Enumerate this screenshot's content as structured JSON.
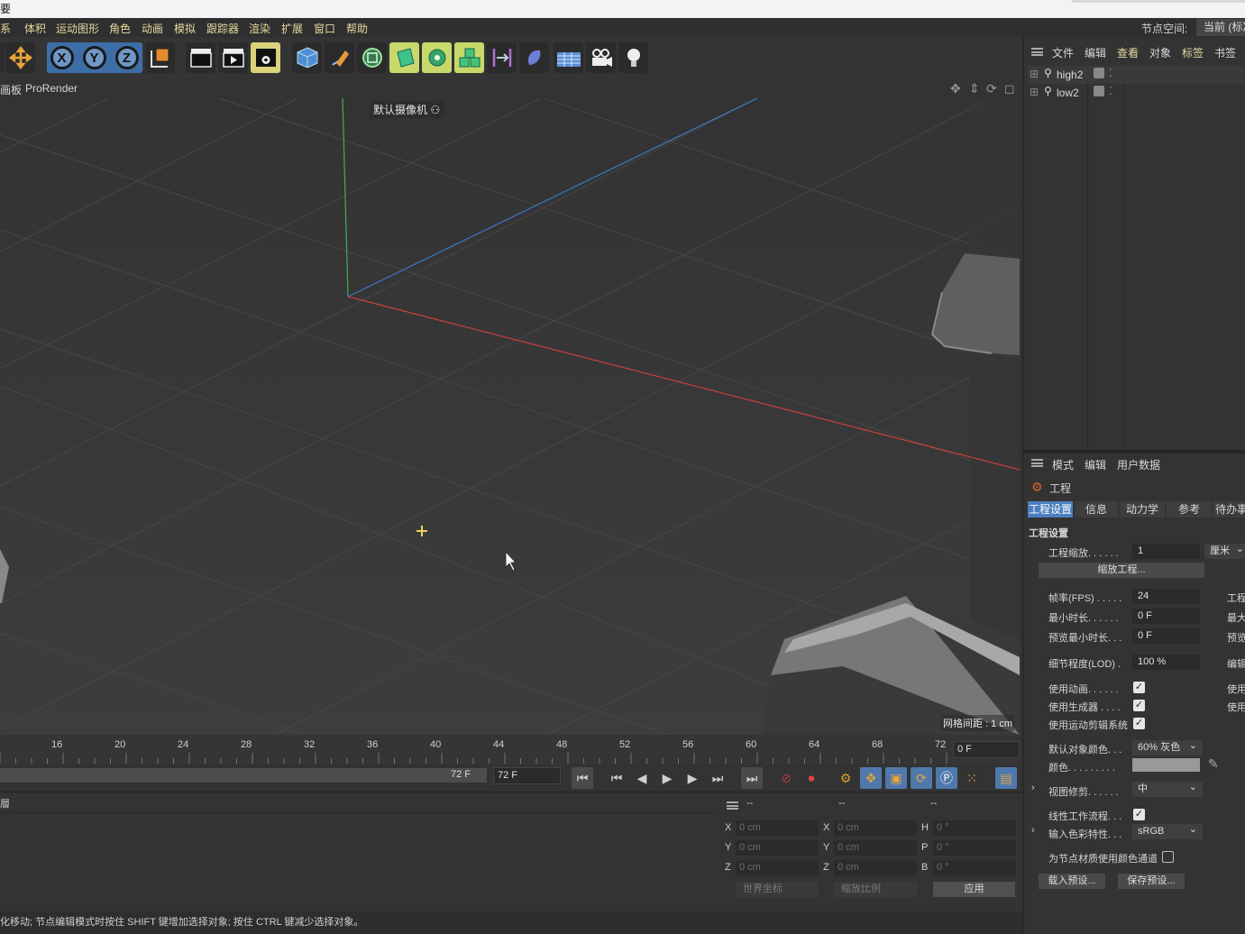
{
  "window": {
    "title_fragment": "要"
  },
  "menubar": {
    "items": [
      "系",
      "体积",
      "运动图形",
      "角色",
      "动画",
      "模拟",
      "跟踪器",
      "渲染",
      "扩展",
      "窗口",
      "帮助"
    ],
    "node_space_label": "节点空间:",
    "node_space_value": "当前 (标准"
  },
  "viewport_header": {
    "left_label": "画板",
    "pro_render": "ProRender"
  },
  "viewport": {
    "camera_label": "默认摄像机",
    "grid_distance": "网格间距 : 1 cm"
  },
  "timeline": {
    "ticks": [
      "16",
      "20",
      "24",
      "28",
      "32",
      "36",
      "40",
      "44",
      "48",
      "52",
      "56",
      "60",
      "64",
      "68",
      "72"
    ],
    "current_frame": "0 F",
    "range_end": "72 F",
    "end_frame": "72 F"
  },
  "coordinates": {
    "col_headers": [
      "--",
      "--",
      "--"
    ],
    "rows": [
      {
        "l1": "X",
        "v1": "0 cm",
        "l2": "X",
        "v2": "0 cm",
        "l3": "H",
        "v3": "0 °"
      },
      {
        "l1": "Y",
        "v1": "0 cm",
        "l2": "Y",
        "v2": "0 cm",
        "l3": "P",
        "v3": "0 °"
      },
      {
        "l1": "Z",
        "v1": "0 cm",
        "l2": "Z",
        "v2": "0 cm",
        "l3": "B",
        "v3": "0 °"
      }
    ],
    "world_coords": "世界坐标",
    "scale_ratio": "缩放比例",
    "apply": "应用"
  },
  "bottom_left_label": "層",
  "status": "化移动; 节点编辑模式时按住 SHIFT 键增加选择对象; 按住 CTRL 键减少选择对象。",
  "object_manager": {
    "menu": [
      "文件",
      "编辑",
      "查看",
      "对象",
      "标签",
      "书签"
    ],
    "objects": [
      "high2",
      "low2"
    ]
  },
  "attribute_manager": {
    "menu": [
      "模式",
      "编辑",
      "用户数据"
    ],
    "title": "工程",
    "tabs": [
      "工程设置",
      "信息",
      "动力学",
      "参考",
      "待办事"
    ],
    "section": "工程设置",
    "scale_label": "工程缩放. . . . . .",
    "scale_value": "1",
    "scale_unit": "厘米",
    "scale_button": "缩放工程...",
    "fps_label": "帧率(FPS) . . . . .",
    "fps_value": "24",
    "min_time_label": "最小时长. . . . . .",
    "min_time_value": "0 F",
    "preview_min_label": "预览最小时长. . .",
    "preview_min_value": "0 F",
    "lod_label": "细节程度(LOD) .",
    "lod_value": "100 %",
    "right_col": [
      "工程",
      "最大",
      "预览",
      "编辑",
      "使用",
      "使用"
    ],
    "use_anim": "使用动画. . . . . .",
    "use_gen": "使用生成器 . . . .",
    "use_motion": "使用运动剪辑系统",
    "default_color_label": "默认对象颜色. . .",
    "default_color_value": "60% 灰色",
    "color_label": "颜色. . . . . . . . .",
    "view_clip_label": "视图修剪. . . . . .",
    "view_clip_value": "中",
    "linear_label": "线性工作流程. . .",
    "input_color_label": "输入色彩特性. . .",
    "input_color_value": "sRGB",
    "node_mat_label": "为节点材质使用颜色通道",
    "load_preset": "载入预设...",
    "save_preset": "保存预设..."
  }
}
